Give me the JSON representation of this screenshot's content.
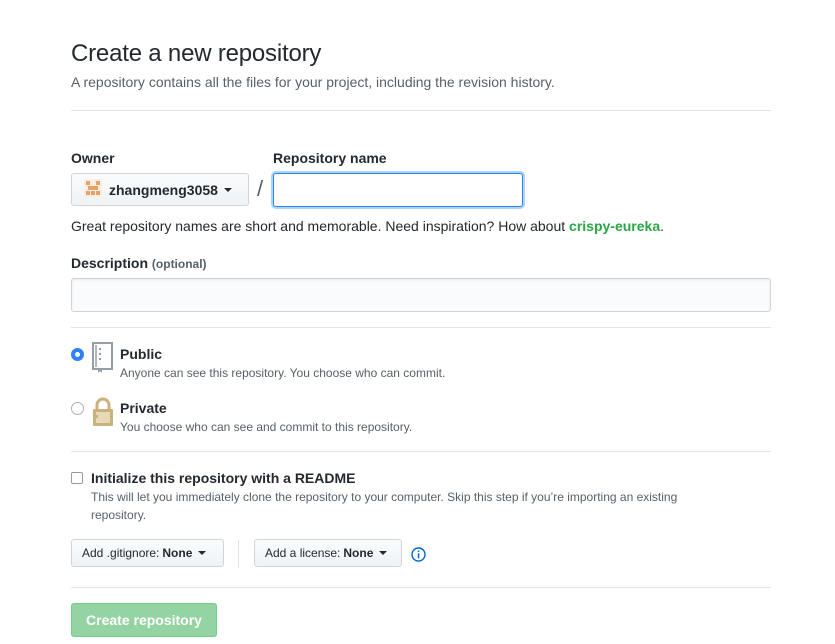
{
  "header": {
    "title": "Create a new repository",
    "subtitle": "A repository contains all the files for your project, including the revision history."
  },
  "owner": {
    "label": "Owner",
    "value": "zhangmeng3058"
  },
  "repo": {
    "label": "Repository name",
    "value": "",
    "slash": "/"
  },
  "hint": {
    "text": "Great repository names are short and memorable. Need inspiration? How about ",
    "suggestion": "crispy-eureka",
    "end": "."
  },
  "description": {
    "label": "Description",
    "optional": "(optional)",
    "value": ""
  },
  "visibility": {
    "public_title": "Public",
    "public_note": "Anyone can see this repository. You choose who can commit.",
    "private_title": "Private",
    "private_note": "You choose who can see and commit to this repository.",
    "selected": "public"
  },
  "readme": {
    "title": "Initialize this repository with a README",
    "note_line1": "This will let you immediately clone the repository to your computer. Skip this step if you’re importing an existing",
    "note_line2": "repository.",
    "checked": false
  },
  "gitignore": {
    "label": "Add .gitignore:",
    "value": "None"
  },
  "license": {
    "label": "Add a license:",
    "value": "None"
  },
  "icons": {
    "owner_avatar": "identicon-avatar",
    "public": "repo-book-icon",
    "private": "lock-icon",
    "info": "info-icon"
  },
  "colors": {
    "accent_blue": "#2188ff",
    "suggestion_green": "#28a745",
    "create_button_disabled": "#94d3a2",
    "lock_tan": "#c9b27c"
  },
  "submit": {
    "label": "Create repository"
  }
}
